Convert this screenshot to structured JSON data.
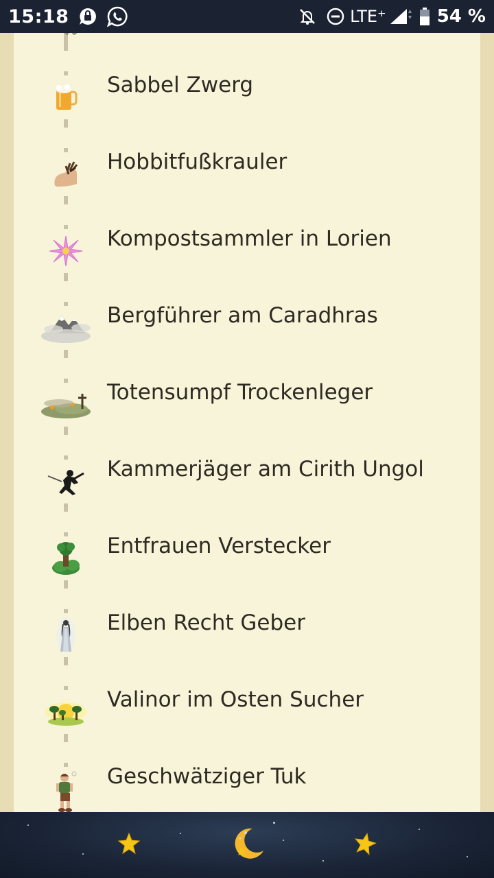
{
  "status_bar": {
    "time": "15:18",
    "network": "LTE⁺",
    "battery": "54 %"
  },
  "list": {
    "items": [
      {
        "label": "Sabbel Zwerg",
        "icon": "beer-mug-icon"
      },
      {
        "label": "Hobbitfußkrauler",
        "icon": "hairy-foot-icon"
      },
      {
        "label": "Kompostsammler in Lorien",
        "icon": "pink-flower-icon"
      },
      {
        "label": "Bergführer am Caradhras",
        "icon": "misty-mountain-icon"
      },
      {
        "label": "Totensumpf Trockenleger",
        "icon": "dead-marshes-icon"
      },
      {
        "label": "Kammerjäger am Cirith Ungol",
        "icon": "fighter-silhouette-icon"
      },
      {
        "label": "Entfrauen Verstecker",
        "icon": "tree-icon"
      },
      {
        "label": "Elben Recht Geber",
        "icon": "elf-figure-icon"
      },
      {
        "label": "Valinor im Osten Sucher",
        "icon": "sunrise-trees-icon"
      },
      {
        "label": "Geschwätziger Tuk",
        "icon": "hobbit-figure-icon"
      }
    ]
  },
  "bottom_nav": {
    "left": "star-icon",
    "center": "moon-star-icon",
    "right": "star-icon"
  },
  "colors": {
    "status_bar_bg": "#1b2333",
    "card_bg": "#f8f4d9",
    "page_bg": "#e8dcb5",
    "text": "#2d2a22",
    "star": "#f5c518"
  }
}
